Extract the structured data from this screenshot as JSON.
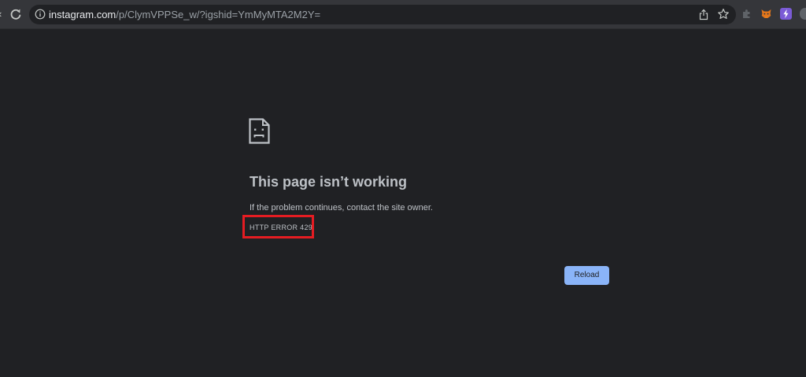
{
  "browser": {
    "url_host": "instagram.com",
    "url_path": "/p/ClymVPPSe_w/?igshid=YmMyMTA2M2Y=",
    "extensions": [
      "puzzle-icon",
      "fox-icon",
      "purple-bolt-icon"
    ]
  },
  "error": {
    "icon": "sad-page-icon",
    "title": "This page isn’t working",
    "description": "If the problem continues, contact the site owner.",
    "code": "HTTP ERROR 429",
    "highlight_color": "#e51c22"
  },
  "actions": {
    "reload_label": "Reload",
    "reload_color": "#8ab4f8"
  },
  "theme": {
    "background": "#202124",
    "text": "#bdc1c6"
  }
}
